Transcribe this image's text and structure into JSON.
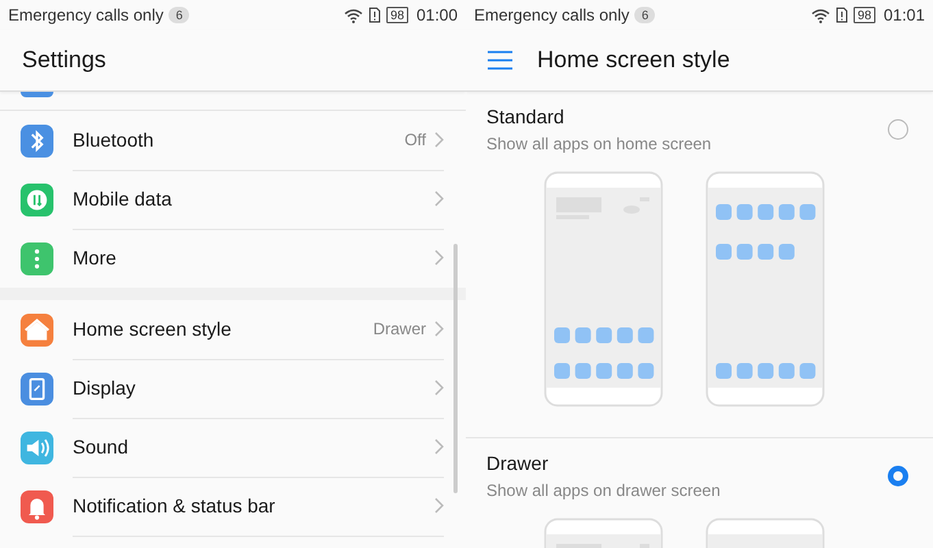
{
  "panels": [
    {
      "status_bar": {
        "carrier": "Emergency calls only",
        "notifications": "6",
        "battery": "98",
        "time": "01:00"
      },
      "title": "Settings",
      "groups": [
        [
          {
            "label": "Bluetooth",
            "value": "Off"
          },
          {
            "label": "Mobile data"
          },
          {
            "label": "More"
          }
        ],
        [
          {
            "label": "Home screen style",
            "value": "Drawer"
          },
          {
            "label": "Display"
          },
          {
            "label": "Sound"
          },
          {
            "label": "Notification & status bar"
          }
        ]
      ]
    },
    {
      "status_bar": {
        "carrier": "Emergency calls only",
        "notifications": "6",
        "battery": "98",
        "time": "01:01"
      },
      "title": "Home screen style",
      "options": [
        {
          "label": "Standard",
          "description": "Show all apps on home screen",
          "selected": false
        },
        {
          "label": "Drawer",
          "description": "Show all apps on drawer screen",
          "selected": true
        }
      ]
    }
  ]
}
